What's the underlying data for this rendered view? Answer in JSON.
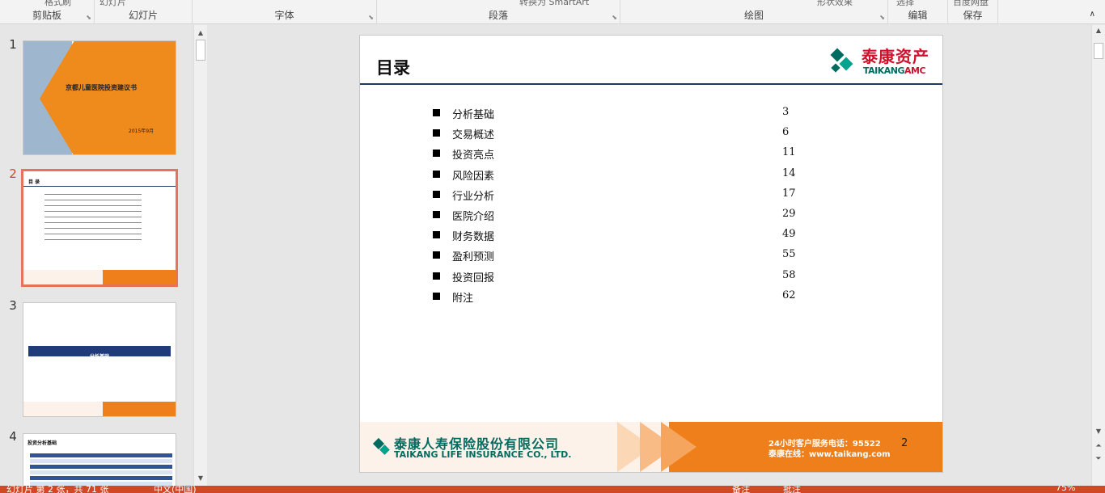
{
  "ribbon": {
    "groups": [
      {
        "label": "剪贴板",
        "partial": "格式刷"
      },
      {
        "label": "幻灯片",
        "partial": "幻灯片"
      },
      {
        "label": "字体",
        "partial": ""
      },
      {
        "label": "段落",
        "partial": "转换为 SmartArt"
      },
      {
        "label": "绘图",
        "partial": "形状效果"
      },
      {
        "label": "编辑",
        "partial": "选择"
      },
      {
        "label": "保存",
        "partial": "百度网盘"
      }
    ]
  },
  "thumbnails": [
    {
      "number": "1",
      "title": "京都儿童医院投资建议书",
      "date": "2015年9月"
    },
    {
      "number": "2",
      "title": "目 录"
    },
    {
      "number": "3",
      "title": "分析基础"
    },
    {
      "number": "4",
      "title": "投资分析基础"
    }
  ],
  "slide": {
    "title": "目录",
    "logo_cn": "泰康资产",
    "logo_en_main": "TAIKANG",
    "logo_en_suffix": "AMC",
    "toc": [
      {
        "name": "分析基础",
        "page": "3"
      },
      {
        "name": "交易概述",
        "page": "6"
      },
      {
        "name": "投资亮点",
        "page": "11"
      },
      {
        "name": "风险因素",
        "page": "14"
      },
      {
        "name": "行业分析",
        "page": "17"
      },
      {
        "name": "医院介绍",
        "page": "29"
      },
      {
        "name": "财务数据",
        "page": "49"
      },
      {
        "name": "盈利预测",
        "page": "55"
      },
      {
        "name": "投资回报",
        "page": "58"
      },
      {
        "name": "附注",
        "page": "62"
      }
    ],
    "footer": {
      "company_cn": "泰康人寿保险股份有限公司",
      "company_en": "TAIKANG LIFE INSURANCE CO., LTD.",
      "hotline": "24小时客户服务电话：95522",
      "website": "泰康在线：www.taikang.com",
      "page_number": "2"
    }
  },
  "status_bar": {
    "slide_info": "幻灯片 第 2 张，共 71 张",
    "language": "中文(中国)",
    "notes": "备注",
    "comments": "批注",
    "zoom": "75%"
  },
  "colors": {
    "accent": "#d24726",
    "brand_red": "#d0122c",
    "brand_green": "#006b5f",
    "footer_orange": "#ef7f1a",
    "title_rule": "#1f3864"
  }
}
